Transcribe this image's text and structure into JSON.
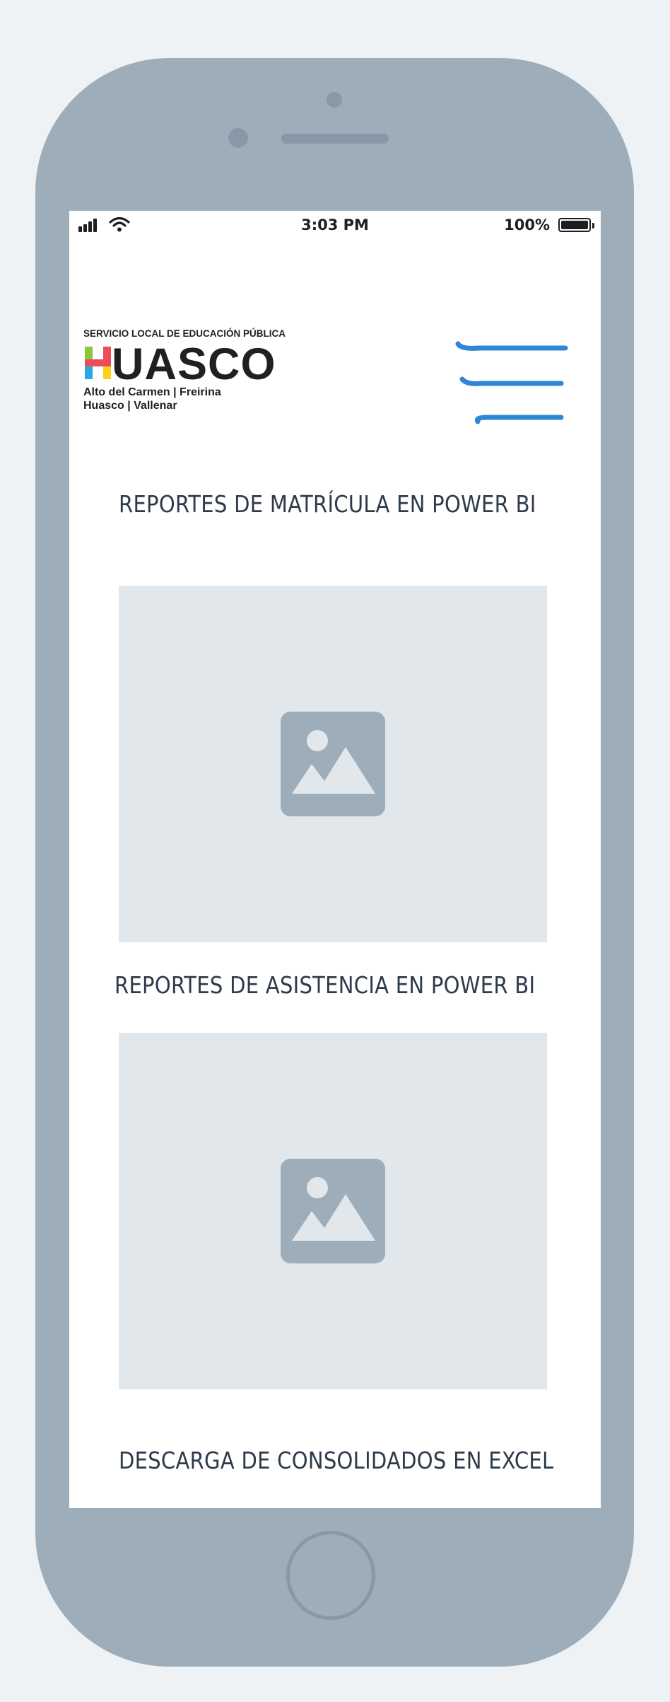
{
  "status_bar": {
    "time": "3:03 PM",
    "battery_percent": "100%",
    "battery_level": 1.0,
    "signal_icon": "signal-bars-icon",
    "wifi_icon": "wifi-icon",
    "battery_icon": "battery-icon"
  },
  "header": {
    "logo": {
      "service_text": "SERVICIO LOCAL DE EDUCACIÓN PÚBLICA",
      "wordmark": "UASCO",
      "wordmark_initial": "H",
      "communes_line1": "Alto del Carmen  |  Freirina",
      "communes_line2": "Huasco  |  Vallenar"
    },
    "menu_icon": "hamburger-menu-icon"
  },
  "sections": [
    {
      "title": "REPORTES DE MATRÍCULA EN POWER BI",
      "image_icon": "image-placeholder-icon"
    },
    {
      "title": "REPORTES DE ASISTENCIA EN POWER BI",
      "image_icon": "image-placeholder-icon"
    },
    {
      "title": "DESCARGA DE CONSOLIDADOS EN EXCEL"
    }
  ],
  "colors": {
    "phone_frame": "#9dadba",
    "screen_bg": "#ffffff",
    "placeholder_bg": "#e2e7eb",
    "placeholder_icon": "#9dadba",
    "menu_stroke": "#2f86d6",
    "title_text": "#2d3a4a",
    "logo_green": "#8cc63f",
    "logo_red": "#ed4a5a",
    "logo_blue": "#29a8e0",
    "logo_yellow": "#fcd116"
  }
}
